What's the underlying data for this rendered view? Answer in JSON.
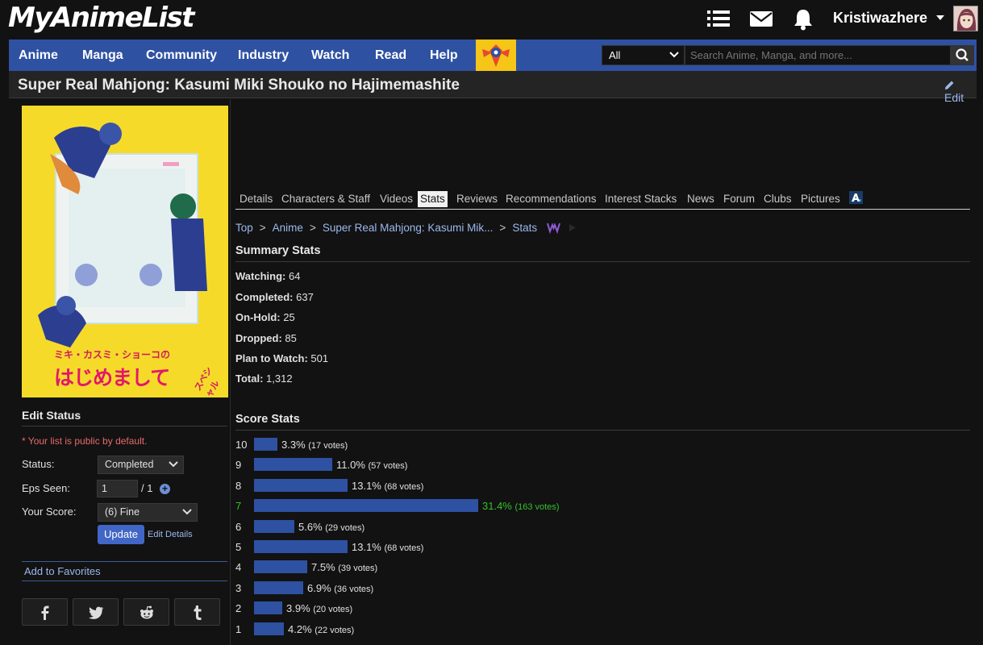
{
  "header": {
    "logo": "MyAnimeList",
    "username": "Kristiwazhere"
  },
  "nav": {
    "items": [
      "Anime",
      "Manga",
      "Community",
      "Industry",
      "Watch",
      "Read",
      "Help"
    ],
    "search_filter": "All",
    "search_placeholder": "Search Anime, Manga, and more..."
  },
  "title": {
    "text": "Super Real Mahjong: Kasumi Miki Shouko no Hajimemashite",
    "edit_label": "Edit"
  },
  "sidebar": {
    "cover_text": "ミキ・カスミ・ショーコの",
    "cover_title": "はじめまして",
    "cover_badge": "スペシャル",
    "edit_status_heading": "Edit Status",
    "public_note": "* Your list is public by default.",
    "status_label": "Status:",
    "status_value": "Completed",
    "eps_label": "Eps Seen:",
    "eps_value": "1",
    "eps_total": "/ 1",
    "score_label": "Your Score:",
    "score_value": "(6) Fine",
    "update_label": "Update",
    "edit_details_label": "Edit Details",
    "favorites_label": "Add to Favorites"
  },
  "tabs": [
    "Details",
    "Characters & Staff",
    "Videos",
    "Stats",
    "Reviews",
    "Recommendations",
    "Interest Stacks",
    "News",
    "Forum",
    "Clubs",
    "Pictures"
  ],
  "active_tab": "Stats",
  "breadcrumb": [
    "Top",
    "Anime",
    "Super Real Mahjong: Kasumi Mik...",
    "Stats"
  ],
  "summary": {
    "heading": "Summary Stats",
    "rows": [
      {
        "label": "Watching:",
        "value": "64"
      },
      {
        "label": "Completed:",
        "value": "637"
      },
      {
        "label": "On-Hold:",
        "value": "25"
      },
      {
        "label": "Dropped:",
        "value": "85"
      },
      {
        "label": "Plan to Watch:",
        "value": "501"
      },
      {
        "label": "Total:",
        "value": "1,312"
      }
    ]
  },
  "score_stats": {
    "heading": "Score Stats",
    "user_score": 7,
    "rows": [
      {
        "score": "10",
        "percent": 3.3,
        "percent_label": "3.3%",
        "votes": "(17 votes)"
      },
      {
        "score": "9",
        "percent": 11.0,
        "percent_label": "11.0%",
        "votes": "(57 votes)"
      },
      {
        "score": "8",
        "percent": 13.1,
        "percent_label": "13.1%",
        "votes": "(68 votes)"
      },
      {
        "score": "7",
        "percent": 31.4,
        "percent_label": "31.4%",
        "votes": "(163 votes)"
      },
      {
        "score": "6",
        "percent": 5.6,
        "percent_label": "5.6%",
        "votes": "(29 votes)"
      },
      {
        "score": "5",
        "percent": 13.1,
        "percent_label": "13.1%",
        "votes": "(68 votes)"
      },
      {
        "score": "4",
        "percent": 7.5,
        "percent_label": "7.5%",
        "votes": "(39 votes)"
      },
      {
        "score": "3",
        "percent": 6.9,
        "percent_label": "6.9%",
        "votes": "(36 votes)"
      },
      {
        "score": "2",
        "percent": 3.9,
        "percent_label": "3.9%",
        "votes": "(20 votes)"
      },
      {
        "score": "1",
        "percent": 4.2,
        "percent_label": "4.2%",
        "votes": "(22 votes)"
      }
    ]
  }
}
